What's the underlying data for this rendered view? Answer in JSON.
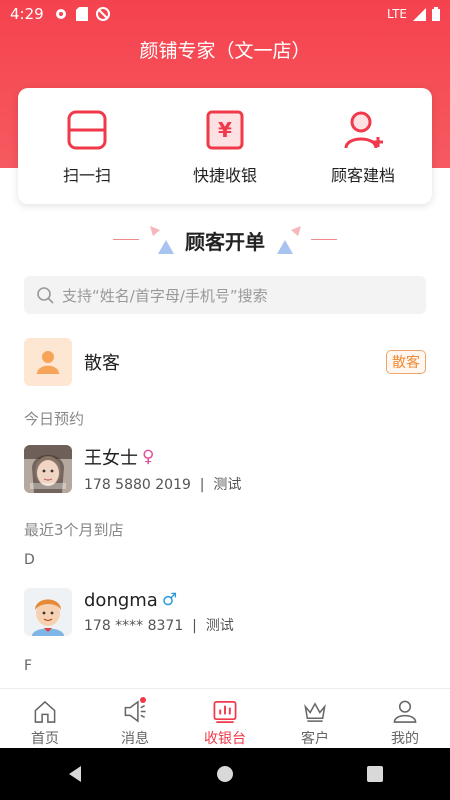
{
  "status_bar": {
    "time": "4:29",
    "network": "LTE"
  },
  "header": {
    "title": "颜铺专家（文一店）"
  },
  "quick_actions": [
    {
      "label": "扫一扫",
      "icon": "scan-icon"
    },
    {
      "label": "快捷收银",
      "icon": "yen-cashier-icon"
    },
    {
      "label": "顾客建档",
      "icon": "add-user-icon"
    }
  ],
  "section": {
    "title": "顾客开单"
  },
  "search": {
    "placeholder": "支持“姓名/首字母/手机号”搜索"
  },
  "walk_in": {
    "name": "散客",
    "tag": "散客"
  },
  "groups": {
    "today": "今日预约",
    "recent": "最近3个月到店",
    "letter_d": "D",
    "letter_f": "F"
  },
  "customers": [
    {
      "name": "王女士",
      "gender": "♀",
      "phone": "178 5880 2019",
      "note": "测试",
      "gender_color": "#e04d9a"
    },
    {
      "name": "dongma",
      "gender": "♂",
      "phone": "178 **** 8371",
      "note": "测试",
      "gender_color": "#2a9ad8"
    }
  ],
  "tabs": [
    {
      "label": "首页",
      "icon": "home-icon"
    },
    {
      "label": "消息",
      "icon": "megaphone-icon"
    },
    {
      "label": "收银台",
      "icon": "cashier-chart-icon"
    },
    {
      "label": "客户",
      "icon": "crown-icon"
    },
    {
      "label": "我的",
      "icon": "profile-icon"
    }
  ],
  "colors": {
    "brand": "#f5424f",
    "accent": "#f0394a",
    "tag_orange": "#f08a36"
  }
}
